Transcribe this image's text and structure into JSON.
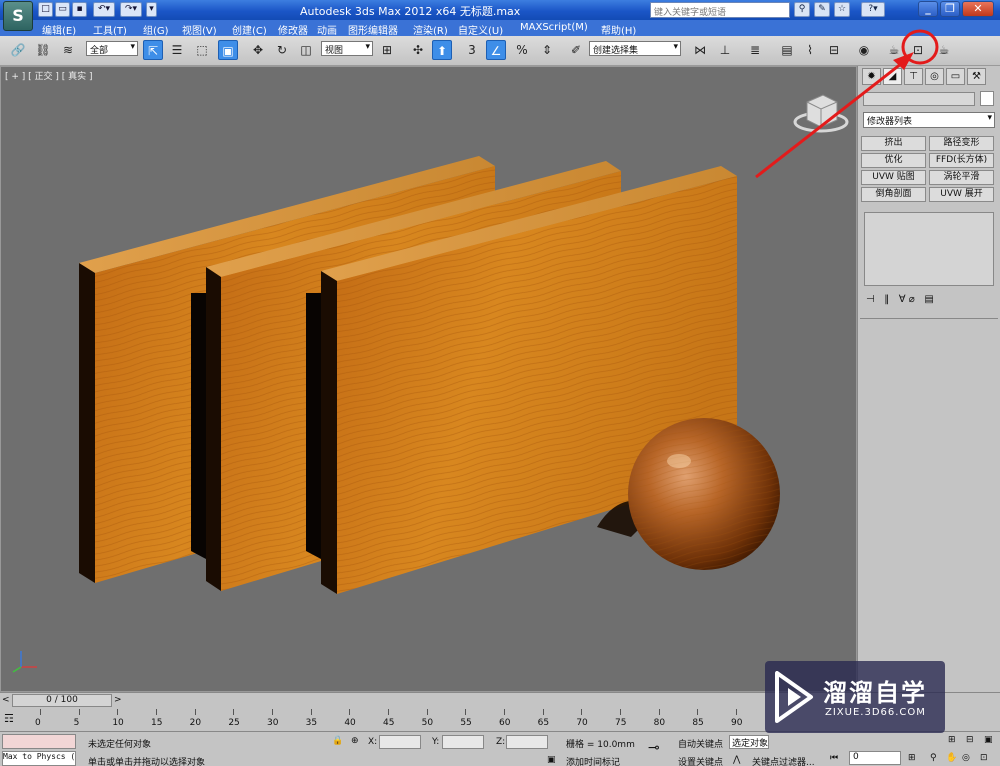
{
  "app": {
    "logo": "S",
    "title": "Autodesk 3ds Max  2012 x64    无标题.max",
    "search_placeholder": "键入关键字或短语"
  },
  "quick_access": [
    "new-icon",
    "open-icon",
    "save-icon",
    "undo-icon",
    "redo-icon",
    "dropdown-icon"
  ],
  "title_icons": [
    "binoculars-icon",
    "tools-icon",
    "star-icon",
    "help-icon"
  ],
  "window_buttons": [
    "minimize",
    "restore",
    "close"
  ],
  "menu": [
    "编辑(E)",
    "工具(T)",
    "组(G)",
    "视图(V)",
    "创建(C)",
    "修改器",
    "动画",
    "图形编辑器",
    "渲染(R)",
    "自定义(U)",
    "MAXScript(M)",
    "帮助(H)"
  ],
  "toolbar": {
    "selection_filter": "全部",
    "reference_coord": "视图",
    "snap_label": "3",
    "named_selection": "创建选择集",
    "render_setup_highlighted": true
  },
  "viewport": {
    "label": "[ + ] [ 正交 ] [ 真实 ]",
    "background": "#6f6f6f"
  },
  "command_panel": {
    "modifier_list": "修改器列表",
    "modifier_buttons": [
      "挤出",
      "路径变形",
      "优化",
      "FFD(长方体)",
      "UVW 贴图",
      "涡轮平滑",
      "倒角剖面",
      "UVW 展开"
    ]
  },
  "time_slider": {
    "frame_readout": "0 / 100"
  },
  "trackbar_ticks": [
    "0",
    "5",
    "10",
    "15",
    "20",
    "25",
    "30",
    "35",
    "40",
    "45",
    "50",
    "55",
    "60",
    "65",
    "70",
    "75",
    "80",
    "85",
    "90"
  ],
  "status": {
    "script_listener": "Max to Physcs (",
    "selection_status": "未选定任何对象",
    "prompt": "单击或单击并拖动以选择对象",
    "x_label": "X:",
    "y_label": "Y:",
    "z_label": "Z:",
    "grid": "栅格 = 10.0mm",
    "add_time_tag": "添加时间标记",
    "auto_key": "自动关键点",
    "selected_dropdown": "选定对象",
    "set_key": "设置关键点",
    "key_filters": "关键点过滤器...",
    "current_frame": "0"
  },
  "watermark": {
    "title": "溜溜自学",
    "url": "ZIXUE.3D66.COM"
  },
  "annotation": {
    "color": "#e31b1b"
  }
}
